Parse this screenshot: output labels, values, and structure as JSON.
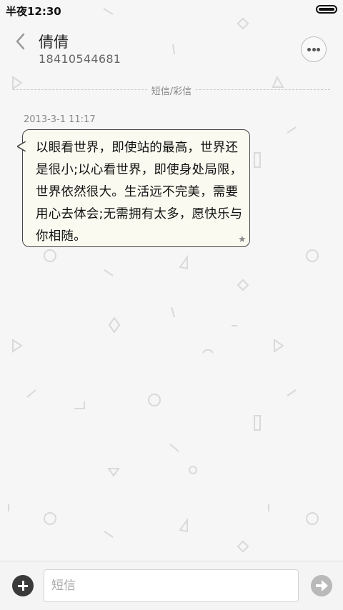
{
  "status_bar": {
    "time": "半夜12:30"
  },
  "header": {
    "contact_name": "倩倩",
    "phone": "18410544681"
  },
  "channel_label": "短信/彩信",
  "message": {
    "timestamp": "2013-3-1 11:17",
    "text": "以眼看世界，即使站的最高，世界还是很小;以心看世界，即使身处局限，世界依然很大。生活远不完美，需要用心去体会;无需拥有太多，愿快乐与你相随。"
  },
  "compose": {
    "placeholder": "短信",
    "value": ""
  },
  "icons": {
    "back": "chevron-left-icon",
    "more": "more-dots-icon",
    "add": "plus-circle-icon",
    "send": "arrow-right-circle-icon",
    "star": "star-icon",
    "battery": "battery-icon"
  },
  "colors": {
    "background": "#f6f6f6",
    "bubble_fill": "#fafaf0",
    "bubble_border": "#444444",
    "send_disabled": "#b9b9b9"
  }
}
